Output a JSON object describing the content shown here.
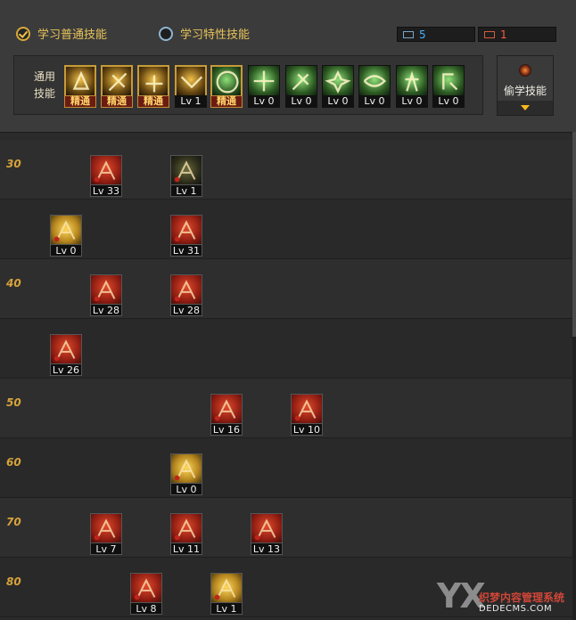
{
  "tabs": {
    "normal": "学习普通技能",
    "trait": "学习特性技能"
  },
  "points": {
    "blue": "5",
    "red": "1"
  },
  "common": {
    "label_line1": "通用",
    "label_line2": "技能",
    "skills": [
      {
        "lv": "精通",
        "master": true,
        "icon": "grab-icon"
      },
      {
        "lv": "精通",
        "master": true,
        "icon": "slash-icon"
      },
      {
        "lv": "精通",
        "master": true,
        "icon": "dash-icon"
      },
      {
        "lv": "Lv 1",
        "master": false,
        "icon": "wings-icon"
      },
      {
        "lv": "精通",
        "master": true,
        "icon": "target-icon"
      },
      {
        "lv": "Lv 0",
        "master": false,
        "icon": "crosshair-icon"
      },
      {
        "lv": "Lv 0",
        "master": false,
        "icon": "kick-icon"
      },
      {
        "lv": "Lv 0",
        "master": false,
        "icon": "spark-figure-icon"
      },
      {
        "lv": "Lv 0",
        "master": false,
        "icon": "eye-icon"
      },
      {
        "lv": "Lv 0",
        "master": false,
        "icon": "buff-figure-icon"
      },
      {
        "lv": "Lv 0",
        "master": false,
        "icon": "stance-icon"
      }
    ]
  },
  "steal": {
    "label": "偷学技能"
  },
  "rows": [
    {
      "level": "30"
    },
    {
      "level": ""
    },
    {
      "level": "40"
    },
    {
      "level": ""
    },
    {
      "level": "50"
    },
    {
      "level": "60"
    },
    {
      "level": "70"
    },
    {
      "level": "80"
    }
  ],
  "tree_skills": [
    {
      "lv": "Lv 33",
      "color": "red",
      "icon": "dragon-icon"
    },
    {
      "lv": "Lv 1",
      "color": "dark",
      "icon": "crescent-icon"
    },
    {
      "lv": "Lv 0",
      "color": "gold",
      "icon": "cross-burst-icon"
    },
    {
      "lv": "Lv 31",
      "color": "red",
      "icon": "claw-icon"
    },
    {
      "lv": "Lv 28",
      "color": "red",
      "icon": "explosion-icon"
    },
    {
      "lv": "Lv 28",
      "color": "red",
      "icon": "impact-icon"
    },
    {
      "lv": "Lv 26",
      "color": "red",
      "icon": "spear-icon"
    },
    {
      "lv": "Lv 16",
      "color": "red",
      "icon": "aura-figure-icon"
    },
    {
      "lv": "Lv 10",
      "color": "red",
      "icon": "fury-icon"
    },
    {
      "lv": "Lv 0",
      "color": "gold",
      "icon": "palm-icon"
    },
    {
      "lv": "Lv 7",
      "color": "red",
      "icon": "berserk-icon"
    },
    {
      "lv": "Lv 11",
      "color": "red",
      "icon": "flame-swirl-icon"
    },
    {
      "lv": "Lv 13",
      "color": "red",
      "icon": "flame-ring-icon"
    },
    {
      "lv": "Lv 8",
      "color": "red",
      "icon": "beast-icon"
    },
    {
      "lv": "Lv 1",
      "color": "gold",
      "icon": "helm-icon"
    }
  ],
  "watermark": {
    "logo": "YX",
    "text": "织梦内容管理系统",
    "sub": "DEDECMS.COM"
  }
}
